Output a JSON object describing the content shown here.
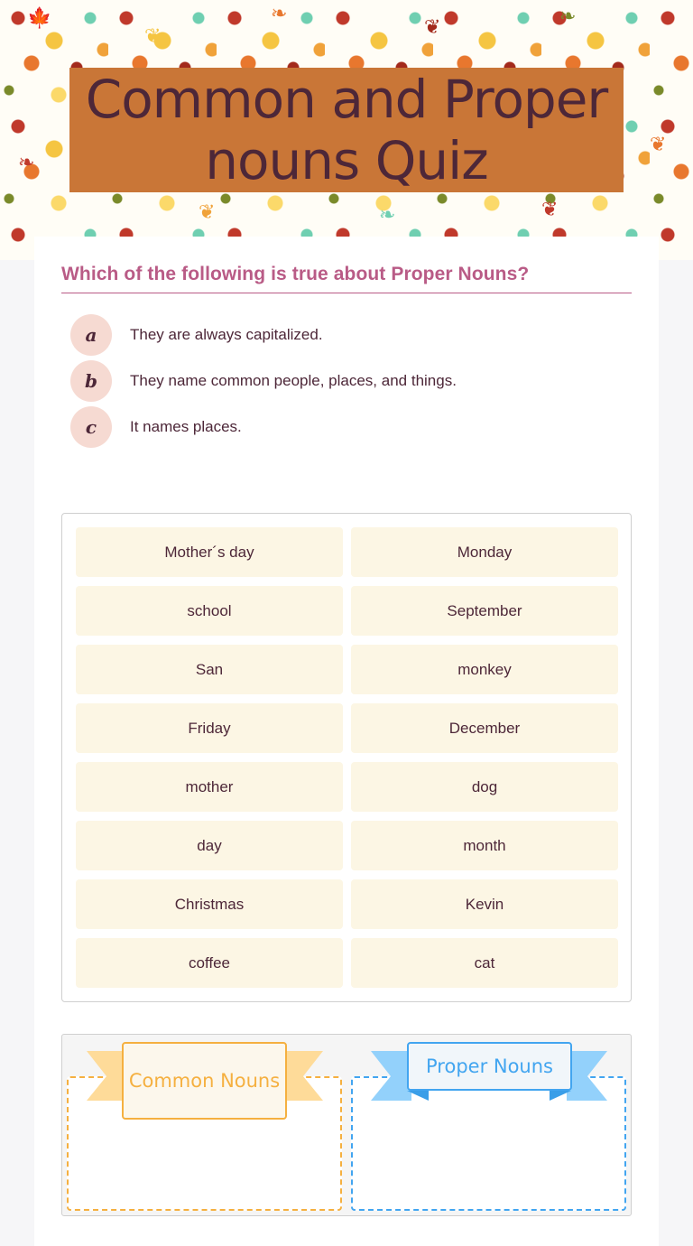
{
  "header": {
    "title": "Common and Proper nouns Quiz"
  },
  "question": {
    "text": "Which of the following is true about Proper Nouns?",
    "options": [
      {
        "letter": "a",
        "text": "They are always capitalized."
      },
      {
        "letter": "b",
        "text": "They name  common people, places, and things."
      },
      {
        "letter": "c",
        "text": "It names places."
      }
    ]
  },
  "word_bank": {
    "words": [
      "Mother´s day",
      "Monday",
      "school",
      "September",
      "San",
      "monkey",
      "Friday",
      "December",
      "mother",
      "dog",
      "day",
      "month",
      "Christmas",
      "Kevin",
      "coffee",
      "cat"
    ]
  },
  "categories": {
    "common": {
      "label": "Common Nouns",
      "color": "#f5b040"
    },
    "proper": {
      "label": "Proper Nouns",
      "color": "#42a5f0"
    }
  },
  "colors": {
    "title_bg": "#c97637",
    "title_text": "#4d2738",
    "question_text": "#b95b86",
    "option_bubble": "#f6dad2",
    "word_bg": "#fcf6e4"
  }
}
